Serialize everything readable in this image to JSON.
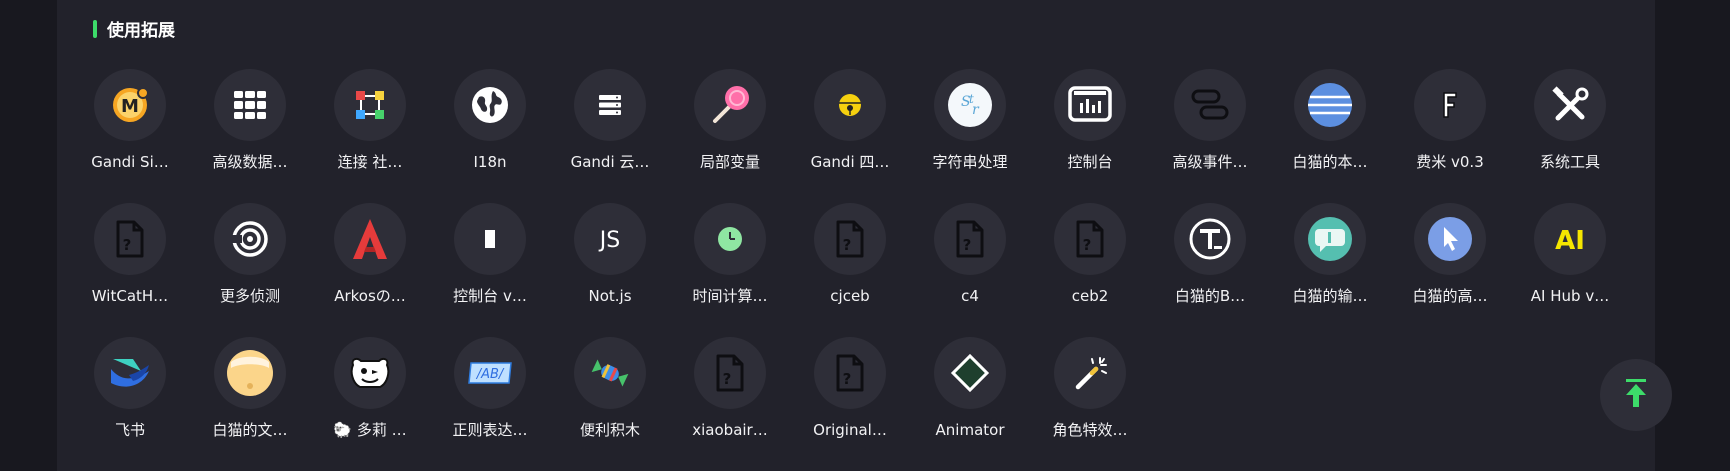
{
  "section": {
    "title": "使用拓展",
    "accent_color": "#3ddc6a"
  },
  "extensions": [
    {
      "label": "Gandi Si…",
      "icon": "m-badge-icon"
    },
    {
      "label": "高级数据…",
      "icon": "grid-icon"
    },
    {
      "label": "连接 社…",
      "icon": "connect-nodes-icon"
    },
    {
      "label": "I18n",
      "icon": "globe-icon"
    },
    {
      "label": "Gandi 云…",
      "icon": "server-icon"
    },
    {
      "label": "局部变量",
      "icon": "lollipop-icon"
    },
    {
      "label": "Gandi 四…",
      "icon": "bell-icon"
    },
    {
      "label": "字符串处理",
      "icon": "string-icon"
    },
    {
      "label": "控制台",
      "icon": "console-chart-icon"
    },
    {
      "label": "高级事件…",
      "icon": "event-blocks-icon"
    },
    {
      "label": "白猫的本…",
      "icon": "database-icon"
    },
    {
      "label": "费米 v0.3",
      "icon": "fermi-f-icon"
    },
    {
      "label": "系统工具",
      "icon": "tools-icon"
    },
    {
      "label": "WitCatH…",
      "icon": "unknown-file-icon"
    },
    {
      "label": "更多侦测",
      "icon": "detect-spiral-icon"
    },
    {
      "label": "Arkosの…",
      "icon": "arkos-a-icon"
    },
    {
      "label": "控制台 v…",
      "icon": "console-bar-icon"
    },
    {
      "label": "Not.js",
      "icon": "js-text-icon"
    },
    {
      "label": "时间计算…",
      "icon": "clock-icon"
    },
    {
      "label": "cjceb",
      "icon": "unknown-file-icon"
    },
    {
      "label": "c4",
      "icon": "unknown-file-icon"
    },
    {
      "label": "ceb2",
      "icon": "unknown-file-icon"
    },
    {
      "label": "白猫的B…",
      "icon": "text-t-icon"
    },
    {
      "label": "白猫的输…",
      "icon": "input-bubble-icon"
    },
    {
      "label": "白猫的高…",
      "icon": "cursor-icon"
    },
    {
      "label": "AI Hub v…",
      "icon": "ai-icon"
    },
    {
      "label": "飞书",
      "icon": "feishu-icon"
    },
    {
      "label": "白猫的文…",
      "icon": "pudding-icon"
    },
    {
      "label": "🐑 多莉 …",
      "icon": "sheep-face-icon"
    },
    {
      "label": "正则表达…",
      "icon": "regex-icon"
    },
    {
      "label": "便利积木",
      "icon": "candy-icon"
    },
    {
      "label": "xiaobair…",
      "icon": "unknown-file-icon"
    },
    {
      "label": "Original…",
      "icon": "unknown-file-icon"
    },
    {
      "label": "Animator",
      "icon": "diamond-icon"
    },
    {
      "label": "角色特效…",
      "icon": "magic-wand-icon"
    }
  ],
  "scroll_top": {
    "icon": "arrow-up-icon",
    "color": "#3ddc6a"
  }
}
